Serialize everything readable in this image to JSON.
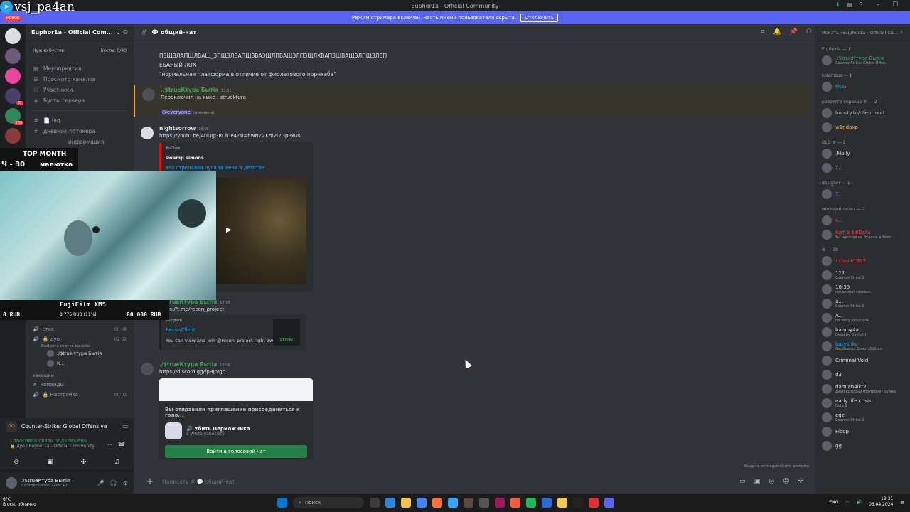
{
  "window": {
    "title": "Euphor1a - Official Community"
  },
  "streamer_banner": {
    "text": "Режим стримера включен. Часть имени пользователя скрыта.",
    "button": "Отключить"
  },
  "overlay": {
    "streamer_name": "vsj_pa4an",
    "top_month_label": "TOP MONTH",
    "top_month_amount": "Ч - 30",
    "top_month_user": "малютка",
    "goal_title": "FujiFilm XM5",
    "goal_collected": "8 775 RUB (11%)",
    "goal_target": "80 000 RUB",
    "goal_left_label": "0 RUB",
    "new_label": "НОВОЕ"
  },
  "server": {
    "name": "Euphor1a - Official Com...",
    "boost_label": "Нужно бустов",
    "boost_value": "Бусты: 0/40",
    "nav": [
      {
        "label": "Мероприятия",
        "icon": "calendar-icon"
      },
      {
        "label": "Просмотр каналов",
        "icon": "browse-icon"
      },
      {
        "label": "Участники",
        "icon": "members-icon"
      },
      {
        "label": "Бусты сервера",
        "icon": "boost-icon"
      }
    ],
    "channels": [
      {
        "label": "📄 faq"
      },
      {
        "label": "дневник-потокера"
      },
      {
        "label": "информация"
      }
    ],
    "voice": [
      {
        "label": "стак",
        "counts": "00 08"
      },
      {
        "label": "🔒 дуо",
        "counts": "02 02",
        "status": "Выбрать статус канала"
      }
    ],
    "voice_users": [
      "./$trueКтура Бытія",
      "К..."
    ],
    "category": "какашки",
    "bottom_channels": [
      {
        "label": "команды"
      },
      {
        "label": "🔒 Настройка",
        "counts": "00 02"
      }
    ]
  },
  "game": {
    "name": "Counter-Strike: Global Offensive",
    "icon_text": "GO"
  },
  "voice_status": {
    "status": "Голосовая связь подключена",
    "channel": "🔒 дуо / Euphor1a - Official Community"
  },
  "user": {
    "name": "./$trueКтура Бытія",
    "status": "Counter-Strike: Glob +1"
  },
  "chat": {
    "channel": "💬 общий-чат",
    "lines": [
      "ПЗЩВЛАПЩЛВАЩ_ЗПЩЗЛВАПЩЗВАЗЩЛПВАЩЗЛПЗЩЛХВАПЗЩВАЩЗЛПЩЗЛВП",
      "ЕБАНЫЙ ЛОХ",
      "\"нормальная платформа в отличие от фиолетового порнхаба\""
    ],
    "msg1": {
      "user": "./$trueКтура Бытія",
      "time": "13:51",
      "text": "Переключил на кике : struektura",
      "mention": "@everyone",
      "edited": "(изменено)"
    },
    "msg2": {
      "user": "nightsorrow",
      "time": "16:06",
      "link": "https://youtu.be/4UQgGRCbTe4?si=hwNZZKm2l2GpPxUK",
      "embed_provider": "YouTube",
      "embed_author": "swamp simons",
      "embed_title": "эта стрелялка пугала меня в детстве..."
    },
    "msg3": {
      "user": "./$trueКтура Бытія",
      "time": "17:19",
      "link": "https://t.me/recon_project",
      "embed_provider": "Telegram",
      "embed_title": "ReconClient",
      "embed_desc": "You can view and join @recon_project right away.",
      "logo_text": "RECON"
    },
    "msg4": {
      "user": "./$trueКтура Бытія",
      "time": "18:00",
      "link": "https://discord.gg/fp9Jtvgc",
      "invite_text": "Вы отправили приглашение присоединиться к голо...",
      "invite_server": "🔊 Убить Перможника",
      "invite_sub": "в WhitalyaSociety",
      "invite_button": "Войти в голосовой чат"
    },
    "composer_placeholder": "Написать # 💬 общий-чат",
    "slowmode": "Защита от медленного режима"
  },
  "members": {
    "search": "Искать «Euphor1a - Official Co...",
    "groups": [
      {
        "title": "Euphoria — 1",
        "rows": [
          {
            "name": "./$trueКтура Бытія",
            "sub": "Counter-Strike: Global Offen...",
            "color": "#3ba55d"
          }
        ]
      },
      {
        "title": "kolambus — 1",
        "rows": [
          {
            "name": "MLG",
            "sub": "",
            "color": "#00a8fc"
          }
        ]
      },
      {
        "title": "работяга сервера ® — 2",
        "rows": [
          {
            "name": "boosty.to/clientmod",
            "sub": "",
            "color": "#b5bac1"
          },
          {
            "name": "w1ndaxp",
            "sub": "",
            "color": "#f0b232"
          }
        ]
      },
      {
        "title": "OLD ⚒ — 2",
        "rows": [
          {
            "name": ".Molly",
            "sub": "",
            "color": "#dbdee1"
          },
          {
            "name": "T...",
            "sub": "",
            "color": "#dbdee1"
          }
        ]
      },
      {
        "title": "designer — 1",
        "rows": [
          {
            "name": "T...",
            "sub": "",
            "color": "#5865f2"
          }
        ]
      },
      {
        "title": "молодой лезет — 2",
        "rows": [
          {
            "name": "s...",
            "sub": "",
            "color": "#f23f43"
          },
          {
            "name": "Ҝøт Ƀ $ΦDrAx",
            "sub": "Ты никогда не будешь в безо...",
            "color": "#f23f43"
          }
        ]
      },
      {
        "title": "⚙ — 38",
        "rows": [
          {
            "name": "! clavik1337",
            "sub": "",
            "color": "#f23f43"
          },
          {
            "name": "111",
            "sub": "Counter-Strike 2",
            "color": "#dbdee1"
          },
          {
            "name": "18:39",
            "sub": "not animal-человек",
            "color": "#dbdee1"
          },
          {
            "name": "a...",
            "sub": "Counter-Strike 2",
            "color": "#dbdee1"
          },
          {
            "name": "A...",
            "sub": "Не могу двадцать...",
            "color": "#dbdee1"
          },
          {
            "name": "bamby4a",
            "sub": "Dead by Daylight",
            "color": "#dbdee1"
          },
          {
            "name": "batyshka",
            "sub": "GeoGuessr: Steam Edition",
            "color": "#00a8fc"
          },
          {
            "name": "Criminal Void",
            "sub": "",
            "color": "#dbdee1"
          },
          {
            "name": "d3",
            "sub": "",
            "color": "#dbdee1"
          },
          {
            "name": "damian4ikt2",
            "sub": "Даун который монтирует хуйню",
            "color": "#dbdee1"
          },
          {
            "name": "early life crisis",
            "sub": "Dota 2",
            "color": "#dbdee1"
          },
          {
            "name": "eqz",
            "sub": "Counter-Strike 2",
            "color": "#dbdee1"
          },
          {
            "name": "Floop",
            "sub": "",
            "color": "#dbdee1"
          },
          {
            "name": "gg",
            "sub": "",
            "color": "#dbdee1"
          }
        ]
      }
    ]
  },
  "taskbar": {
    "weather_temp": "6°C",
    "weather_desc": "В осн. облачно",
    "search": "Поиск",
    "lang": "ENG",
    "time": "19:31",
    "date": "06.04.2024"
  }
}
